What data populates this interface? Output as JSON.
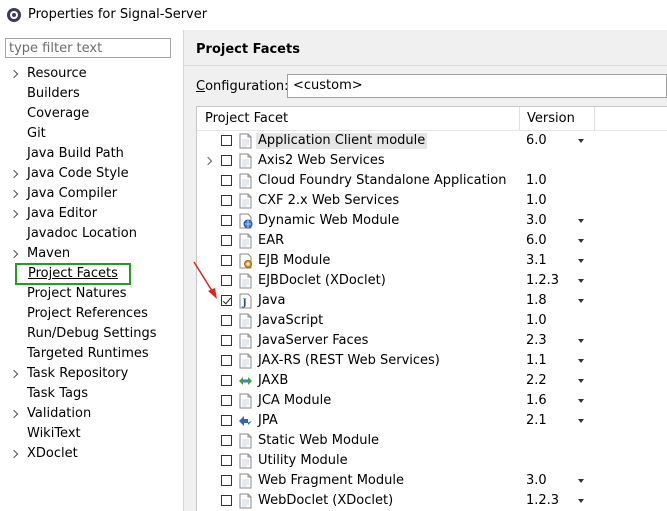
{
  "window": {
    "title": "Properties for Signal-Server"
  },
  "filter": {
    "placeholder": "type filter text"
  },
  "nav": {
    "items": [
      {
        "label": "Resource",
        "expandable": true
      },
      {
        "label": "Builders",
        "expandable": false
      },
      {
        "label": "Coverage",
        "expandable": false
      },
      {
        "label": "Git",
        "expandable": false
      },
      {
        "label": "Java Build Path",
        "expandable": false
      },
      {
        "label": "Java Code Style",
        "expandable": true
      },
      {
        "label": "Java Compiler",
        "expandable": true
      },
      {
        "label": "Java Editor",
        "expandable": true
      },
      {
        "label": "Javadoc Location",
        "expandable": false
      },
      {
        "label": "Maven",
        "expandable": true
      },
      {
        "label": "Project Facets",
        "expandable": false,
        "selected": true
      },
      {
        "label": "Project Natures",
        "expandable": false
      },
      {
        "label": "Project References",
        "expandable": false
      },
      {
        "label": "Run/Debug Settings",
        "expandable": false
      },
      {
        "label": "Targeted Runtimes",
        "expandable": false
      },
      {
        "label": "Task Repository",
        "expandable": true
      },
      {
        "label": "Task Tags",
        "expandable": false
      },
      {
        "label": "Validation",
        "expandable": true
      },
      {
        "label": "WikiText",
        "expandable": false
      },
      {
        "label": "XDoclet",
        "expandable": true
      }
    ]
  },
  "main": {
    "title": "Project Facets",
    "configuration": {
      "label_prefix": "",
      "label_mnemonic": "C",
      "label_rest": "onfiguration:",
      "value": "<custom>"
    },
    "table": {
      "columns": [
        "Project Facet",
        "Version"
      ],
      "rows": [
        {
          "name": "Application Client module",
          "version": "6.0",
          "dropdown": true,
          "checked": false,
          "icon": "doc-icon",
          "expandable": false,
          "highlight": true
        },
        {
          "name": "Axis2 Web Services",
          "version": "",
          "dropdown": false,
          "checked": false,
          "icon": "doc-icon",
          "expandable": true
        },
        {
          "name": "Cloud Foundry Standalone Application",
          "version": "1.0",
          "dropdown": false,
          "checked": false,
          "icon": "doc-icon",
          "expandable": false
        },
        {
          "name": "CXF 2.x Web Services",
          "version": "1.0",
          "dropdown": false,
          "checked": false,
          "icon": "doc-icon",
          "expandable": false
        },
        {
          "name": "Dynamic Web Module",
          "version": "3.0",
          "dropdown": true,
          "checked": false,
          "icon": "web-module-icon",
          "expandable": false
        },
        {
          "name": "EAR",
          "version": "6.0",
          "dropdown": true,
          "checked": false,
          "icon": "doc-icon",
          "expandable": false
        },
        {
          "name": "EJB Module",
          "version": "3.1",
          "dropdown": true,
          "checked": false,
          "icon": "ejb-icon",
          "expandable": false
        },
        {
          "name": "EJBDoclet (XDoclet)",
          "version": "1.2.3",
          "dropdown": true,
          "checked": false,
          "icon": "doc-icon",
          "expandable": false
        },
        {
          "name": "Java",
          "version": "1.8",
          "dropdown": true,
          "checked": true,
          "icon": "java-icon",
          "expandable": false
        },
        {
          "name": "JavaScript",
          "version": "1.0",
          "dropdown": false,
          "checked": false,
          "icon": "doc-icon",
          "expandable": false
        },
        {
          "name": "JavaServer Faces",
          "version": "2.3",
          "dropdown": true,
          "checked": false,
          "icon": "doc-icon",
          "expandable": false
        },
        {
          "name": "JAX-RS (REST Web Services)",
          "version": "1.1",
          "dropdown": true,
          "checked": false,
          "icon": "doc-icon",
          "expandable": false
        },
        {
          "name": "JAXB",
          "version": "2.2",
          "dropdown": true,
          "checked": false,
          "icon": "jaxb-icon",
          "expandable": false
        },
        {
          "name": "JCA Module",
          "version": "1.6",
          "dropdown": true,
          "checked": false,
          "icon": "doc-icon",
          "expandable": false
        },
        {
          "name": "JPA",
          "version": "2.1",
          "dropdown": true,
          "checked": false,
          "icon": "jpa-icon",
          "expandable": false
        },
        {
          "name": "Static Web Module",
          "version": "",
          "dropdown": false,
          "checked": false,
          "icon": "doc-icon",
          "expandable": false
        },
        {
          "name": "Utility Module",
          "version": "",
          "dropdown": false,
          "checked": false,
          "icon": "doc-icon",
          "expandable": false
        },
        {
          "name": "Web Fragment Module",
          "version": "3.0",
          "dropdown": true,
          "checked": false,
          "icon": "doc-icon",
          "expandable": false
        },
        {
          "name": "WebDoclet (XDoclet)",
          "version": "1.2.3",
          "dropdown": true,
          "checked": false,
          "icon": "doc-icon",
          "expandable": false
        }
      ]
    }
  },
  "colors": {
    "selection_border": "#1fa11f",
    "annotation_arrow": "#e0241b",
    "panel_bg": "#f0f0f0"
  }
}
